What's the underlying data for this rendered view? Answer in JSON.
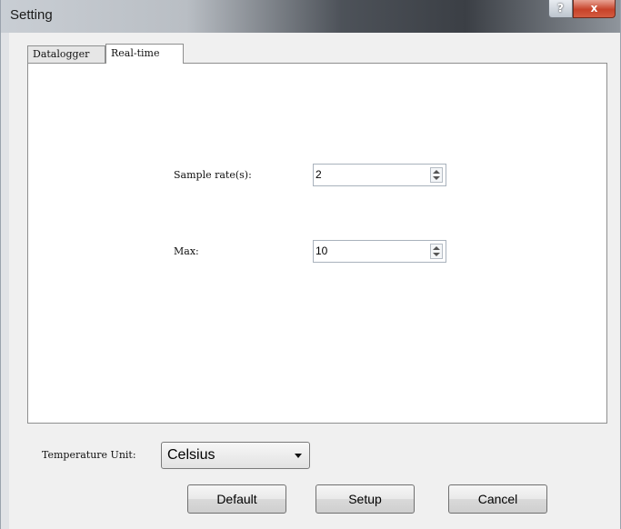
{
  "window": {
    "title": "Setting",
    "help_label": "?",
    "close_label": "x"
  },
  "tabs": [
    {
      "label": "Datalogger",
      "active": false
    },
    {
      "label": "Real-time",
      "active": true
    }
  ],
  "realtime": {
    "sample_rate_label": "Sample rate(s):",
    "sample_rate_value": "2",
    "max_label": "Max:",
    "max_value": "10"
  },
  "temperature_unit": {
    "label": "Temperature Unit:",
    "selected": "Celsius"
  },
  "buttons": {
    "default_label": "Default",
    "setup_label": "Setup",
    "cancel_label": "Cancel"
  },
  "icons": {
    "help": "question-icon",
    "close": "close-icon",
    "spinner": "spin-arrows-icon",
    "dropdown": "chevron-down-icon"
  }
}
